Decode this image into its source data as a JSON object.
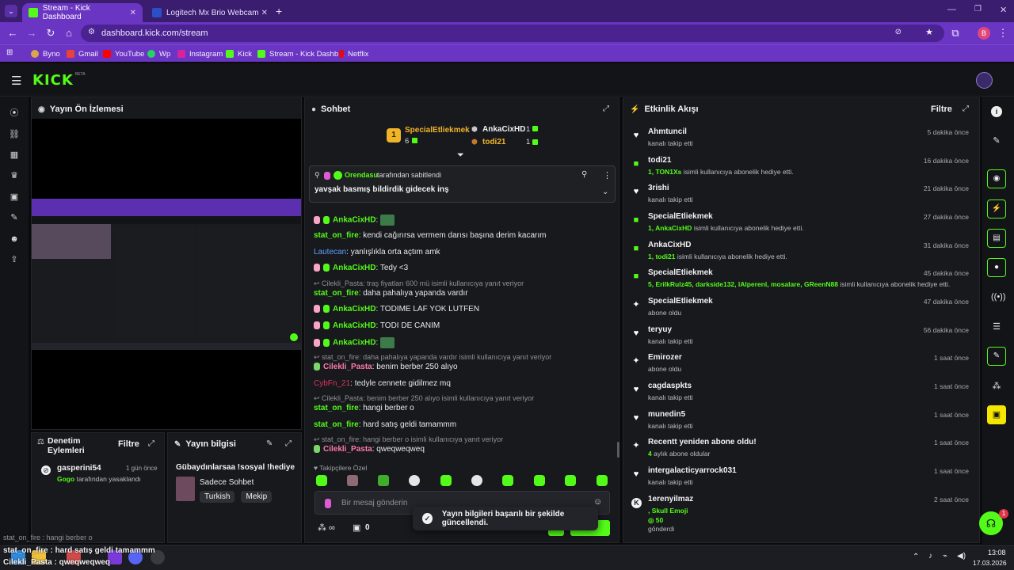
{
  "browser": {
    "tabs": [
      {
        "label": "Stream - Kick Dashboard",
        "active": true
      },
      {
        "label": "Logitech Mx Brio Webcam Fiyatı",
        "active": false
      }
    ],
    "url": "dashboard.kick.com/stream",
    "profile_initial": "B",
    "bookmarks": [
      "Byno",
      "Gmail",
      "YouTube",
      "Wp",
      "Instagram",
      "Kick",
      "Stream - Kick Dashb...",
      "Netflix"
    ]
  },
  "kick": {
    "logo": "KICK",
    "beta": "BETA"
  },
  "preview": {
    "title": "Yayın Ön İzlemesi"
  },
  "moderation": {
    "title": "Denetim Eylemleri",
    "filter": "Filtre",
    "entry": {
      "user": "gasperini54",
      "time": "1 gün önce",
      "by": "Gogo",
      "desc": "tarafından yasaklandı"
    }
  },
  "streaminfo": {
    "title": "Yayın bilgisi",
    "stream_title": "Gübaydınlarsaa !sosyal !hediye",
    "category": "Sadece Sohbet",
    "tags": [
      "Turkish",
      "Mekip"
    ]
  },
  "chat": {
    "title": "Sohbet",
    "leaderboard": [
      {
        "name": "SpecialEtliekmek",
        "rank": "1",
        "count": "6"
      },
      {
        "name": "AnkaCixHD",
        "count": "1"
      },
      {
        "name": "todi21",
        "count": "1"
      }
    ],
    "pinned": {
      "by": "Orendasu",
      "by_suffix": "tarafından sabitlendi",
      "text": "yavşak basmış bildirdik gidecek inş"
    },
    "messages": [
      {
        "user": "AnkaCixHD",
        "text": ""
      },
      {
        "user": "stat_on_fire",
        "text": "kendi cağırırsa vermem darısı başına derim kacarım"
      },
      {
        "user": "Lautecan",
        "text": "yanlışlıkla orta açtım amk"
      },
      {
        "user": "AnkaCixHD",
        "text": "Tedy <3"
      },
      {
        "reply": "Cilekli_Pasta: traş fiyatları 600 mü isimli kullanıcıya yanıt veriyor"
      },
      {
        "user": "stat_on_fire",
        "text": "daha pahalıya yapanda vardır"
      },
      {
        "user": "AnkaCixHD",
        "text": "TODİME LAF YOK LUTFEN"
      },
      {
        "user": "AnkaCixHD",
        "text": "TODİ DE CANİM"
      },
      {
        "user": "AnkaCixHD",
        "text": ""
      },
      {
        "reply": "stat_on_fire: daha pahalıya yapanda vardır isimli kullanıcıya yanıt veriyor"
      },
      {
        "user": "Cilekli_Pasta",
        "text": "benim berber 250 alıyo"
      },
      {
        "user": "CybFn_21",
        "text": "tedyle cennete gidilmez mq"
      },
      {
        "reply": "Cilekli_Pasta: benim berber 250 alıyo isimli kullanıcıya yanıt veriyor"
      },
      {
        "user": "stat_on_fire",
        "text": "hangi berber o"
      },
      {
        "user": "stat_on_fire",
        "text": "hard satış geldi tamammm"
      },
      {
        "reply": "stat_on_fire: hangi berber o isimli kullanıcıya yanıt veriyor"
      },
      {
        "user": "Cilekli_Pasta",
        "text": "qweqweqweq"
      }
    ],
    "emote_section": "Takipçilere Özel",
    "input_placeholder": "Bir mesaj gönderin",
    "points": "0"
  },
  "toast": {
    "text": "Yayın bilgileri başarılı bir şekilde güncellendi."
  },
  "activity": {
    "title": "Etkinlik Akışı",
    "filter": "Filtre",
    "items": [
      {
        "icon": "heart-icon",
        "name": "Ahmtuncil",
        "desc": "kanalı takip etti",
        "time": "5 dakika önce"
      },
      {
        "icon": "gift-icon",
        "name": "todi21",
        "hl": "1, TON1Xs",
        "desc": "isimli kullanıcıya abonelik hediye etti.",
        "time": "16 dakika önce"
      },
      {
        "icon": "heart-icon",
        "name": "3rishi",
        "desc": "kanalı takip etti",
        "time": "21 dakika önce"
      },
      {
        "icon": "gift-icon",
        "name": "SpecialEtliekmek",
        "hl": "1, AnkaCixHD",
        "desc": "isimli kullanıcıya abonelik hediye etti.",
        "time": "27 dakika önce"
      },
      {
        "icon": "gift-icon",
        "name": "AnkaCixHD",
        "hl": "1, todi21",
        "desc": "isimli kullanıcıya abonelik hediye etti.",
        "time": "31 dakika önce"
      },
      {
        "icon": "gift-icon",
        "name": "SpecialEtliekmek",
        "hl": "5, ErilkRulz45, darkside132, lAlperenl, mosalare, GReenN88",
        "desc": "isimli kullanıcıya abonelik hediye etti.",
        "time": "45 dakika önce"
      },
      {
        "icon": "sparkle-icon",
        "name": "SpecialEtliekmek",
        "desc": "abone oldu",
        "time": "47 dakika önce"
      },
      {
        "icon": "heart-icon",
        "name": "teryuy",
        "desc": "kanalı takip etti",
        "time": "56 dakika önce"
      },
      {
        "icon": "sparkle-icon",
        "name": "Emirozer",
        "desc": "abone oldu",
        "time": "1 saat önce"
      },
      {
        "icon": "heart-icon",
        "name": "cagdaspkts",
        "desc": "kanalı takip etti",
        "time": "1 saat önce"
      },
      {
        "icon": "heart-icon",
        "name": "munedin5",
        "desc": "kanalı takip etti",
        "time": "1 saat önce"
      },
      {
        "icon": "sparkle-icon",
        "name": "Recentt yeniden abone oldu!",
        "hl": "4",
        "desc": "aylık abone oldular",
        "time": "1 saat önce"
      },
      {
        "icon": "heart-icon",
        "name": "intergalacticyarrock031",
        "desc": "kanalı takip etti",
        "time": "1 saat önce"
      },
      {
        "icon": "kick-icon",
        "name": "1erenyilmaz",
        "hl": ", Skull Emoji",
        "extra": "50",
        "desc": "gönderdi",
        "time": "2 saat önce"
      }
    ]
  },
  "overlay": {
    "line1": "stat_on_fire : hangi berber o",
    "line2": "stat_on_fire : hard satış geldi tamammm",
    "line3": "Cilekli_Pasta : qweqweqweq"
  },
  "taskbar": {
    "time": "13:08",
    "date": "17.03.2026"
  },
  "support_badge": "1"
}
